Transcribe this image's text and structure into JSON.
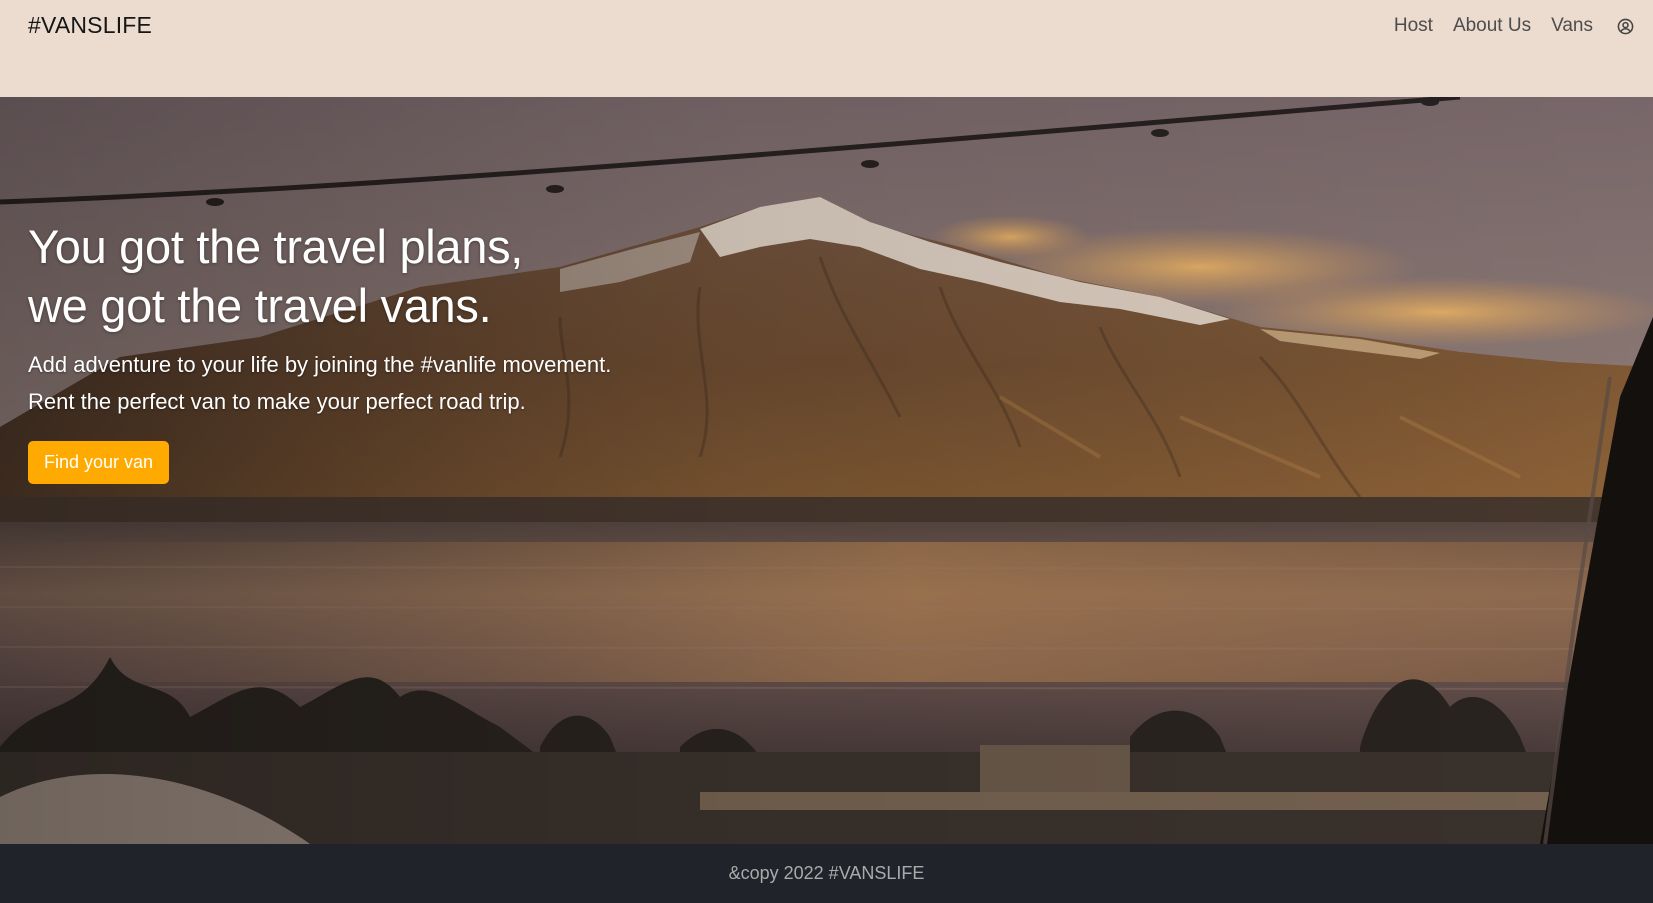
{
  "header": {
    "logo": "#VANSLIFE",
    "nav": [
      {
        "label": "Host"
      },
      {
        "label": "About Us"
      },
      {
        "label": "Vans"
      }
    ],
    "user_icon": "user-circle-icon"
  },
  "hero": {
    "title_line1": "You got the travel plans,",
    "title_line2": "we got the travel vans.",
    "subtitle_line1": "Add adventure to your life by joining the #vanlife movement.",
    "subtitle_line2": "Rent the perfect van to make your perfect road trip.",
    "cta_label": "Find your van"
  },
  "footer": {
    "text": "&copy 2022 #VANSLIFE"
  },
  "colors": {
    "header_bg": "#ecdccf",
    "accent": "#ffaa00",
    "footer_bg": "#20232a"
  }
}
